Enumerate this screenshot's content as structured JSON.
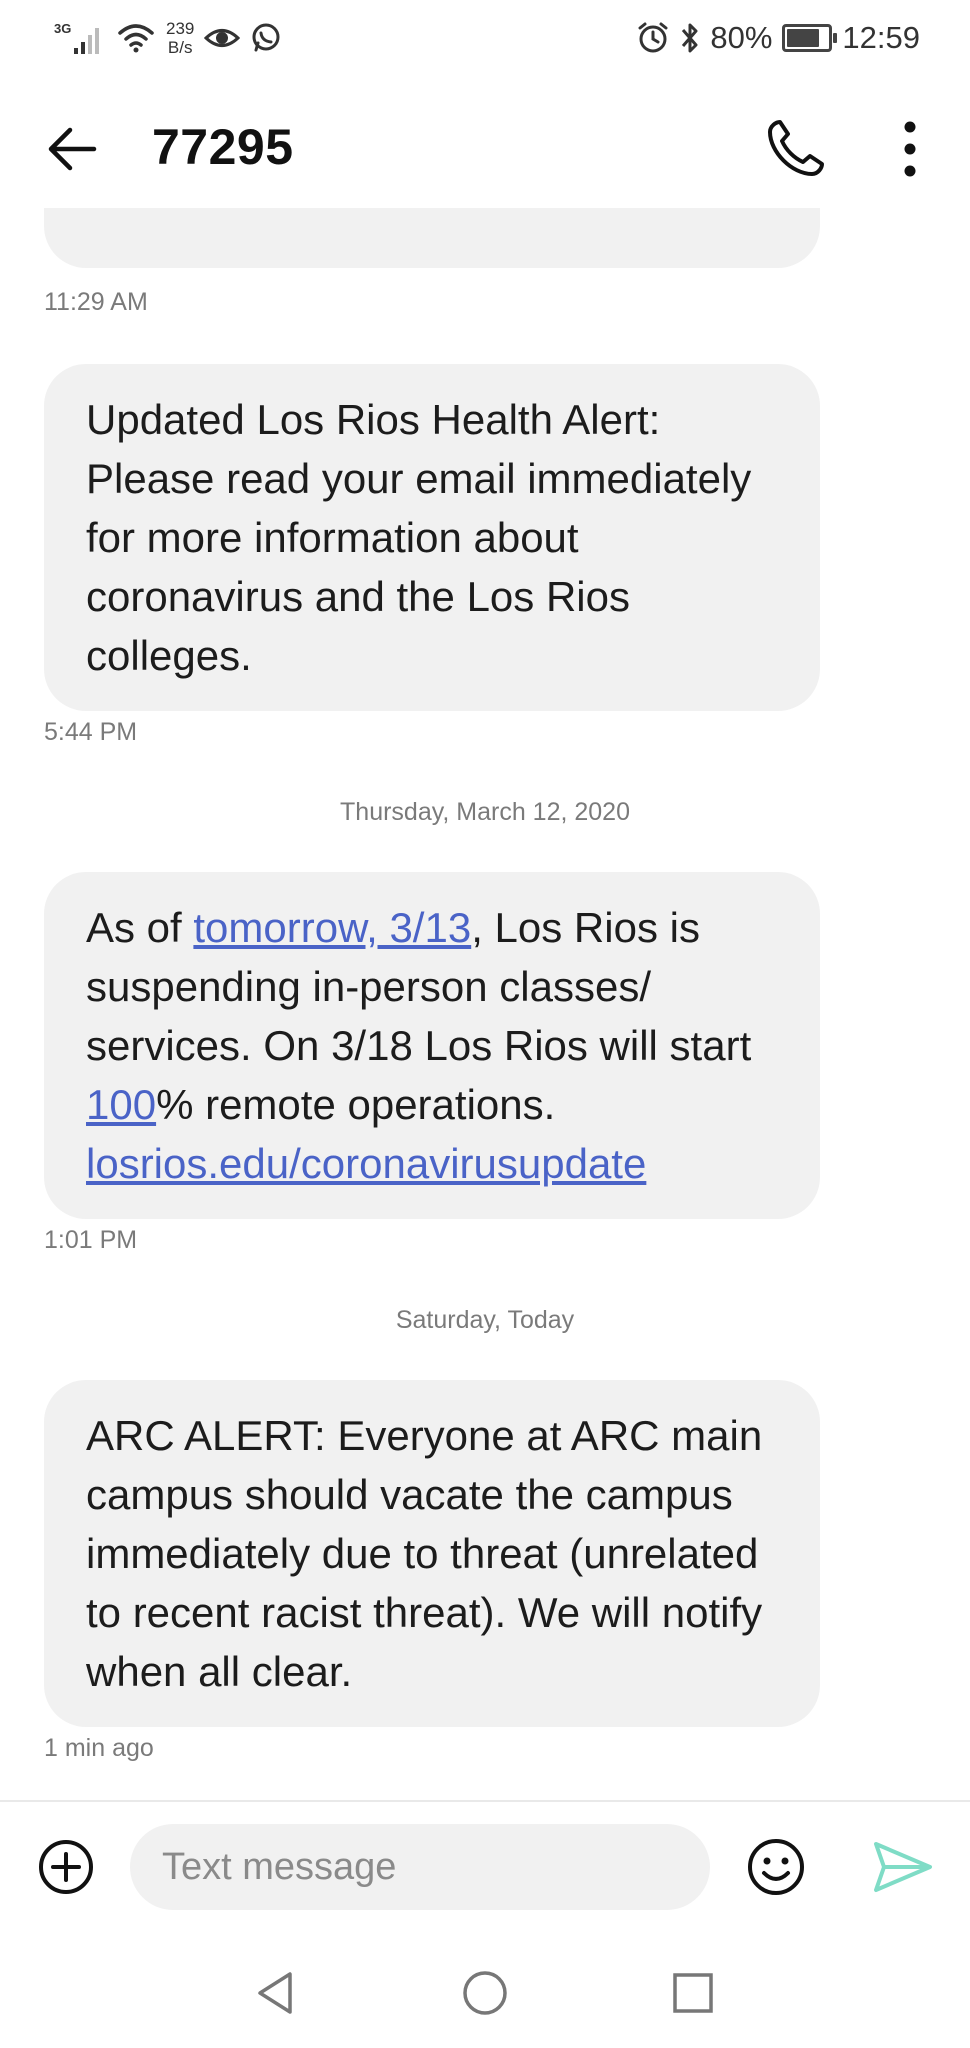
{
  "status_bar": {
    "network": "3G",
    "speed_value": "239",
    "speed_unit": "B/s",
    "battery_percent": "80%",
    "battery_level": 0.8,
    "time": "12:59"
  },
  "header": {
    "title": "77295"
  },
  "messages": [
    {
      "time": "11:29 AM"
    },
    {
      "text": "Updated Los Rios Health Alert: Please read your email immediately for more information about coronavirus and the Los Rios colleges.",
      "time": "5:44 PM"
    },
    {
      "date_separator": "Thursday, March 12, 2020"
    },
    {
      "parts": [
        "As of ",
        "tomorrow, 3/13",
        ", Los Rios is suspending in-person classes/ services. On 3/18 Los Rios will start ",
        "100",
        "% remote operations. ",
        "losrios.edu/coronavirusupdate"
      ],
      "time": "1:01 PM"
    },
    {
      "date_separator": "Saturday, Today"
    },
    {
      "text": "ARC ALERT: Everyone at ARC main campus should vacate the campus immediately due to threat (unrelated to recent racist threat). We will notify when all clear.",
      "time": "1 min ago"
    }
  ],
  "composer": {
    "placeholder": "Text message"
  },
  "colors": {
    "bubble": "#f1f1f1",
    "link": "#4a63c7",
    "send_accent": "#7fdcc6"
  }
}
